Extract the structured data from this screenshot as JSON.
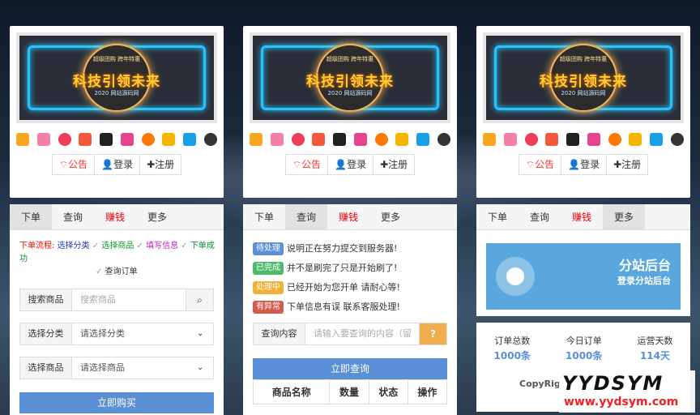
{
  "banner": {
    "line_top": "超级团购 跨年特惠",
    "title": "科技引领未来",
    "line_bottom": "2020 网站源码网"
  },
  "nav_buttons": [
    {
      "label": "公告",
      "icon": "wifi-icon"
    },
    {
      "label": "登录",
      "icon": "user-icon"
    },
    {
      "label": "注册",
      "icon": "plus-icon"
    }
  ],
  "app_icons": [
    "taobao-icon",
    "pinduoduo-icon",
    "redbook-icon",
    "ting-icon",
    "youku-icon",
    "douyin-icon",
    "baby-icon",
    "jd-icon",
    "kuaishou-icon",
    "qq-icon"
  ],
  "app_icon_colors": [
    "#f5a623",
    "#f47fa8",
    "#ee3d5a",
    "#f05a3a",
    "#222",
    "#e84393",
    "#ff7a00",
    "#f6b700",
    "#1aa0e8",
    "#333"
  ],
  "tabs": [
    {
      "label": "下单"
    },
    {
      "label": "查询"
    },
    {
      "label": "赚钱"
    },
    {
      "label": "更多"
    }
  ],
  "order": {
    "flow": [
      "下单流程:",
      "选择分类",
      "选择商品",
      "填写信息",
      "下单成功",
      "查询订单"
    ],
    "search_label": "搜索商品",
    "search_placeholder": "搜索商品",
    "category_label": "选择分类",
    "category_value": "请选择分类",
    "product_label": "选择商品",
    "product_value": "请选择商品",
    "buy_button": "立即购买"
  },
  "query": {
    "statuses": [
      {
        "badge": "待处理",
        "text": "说明正在努力提交到服务器!",
        "color": "#5b8fd6"
      },
      {
        "badge": "已完成",
        "text": "并不是刷完了只是开始刷了!",
        "color": "#4cbb6b"
      },
      {
        "badge": "处理中",
        "text": "已经开始为您开单 请耐心等!",
        "color": "#f2b136"
      },
      {
        "badge": "有异常",
        "text": "下单信息有误 联系客服处理!",
        "color": "#d45a4d"
      }
    ],
    "input_label": "查询内容",
    "input_placeholder": "请输入要查询的内容（留",
    "query_button": "立即查询",
    "table_headers": [
      "商品名称",
      "数量",
      "状态",
      "操作"
    ]
  },
  "more": {
    "substation_title": "分站后台",
    "substation_sub": "登录分站后台",
    "stats": [
      {
        "label": "订单总数",
        "value": "1000条"
      },
      {
        "label": "今日订单",
        "value": "1000条"
      },
      {
        "label": "运营天数",
        "value": "114天"
      }
    ],
    "copyright": "CopyRig"
  },
  "watermark": {
    "brand": "YYDSYM",
    "url": "www.yydsym.com"
  }
}
